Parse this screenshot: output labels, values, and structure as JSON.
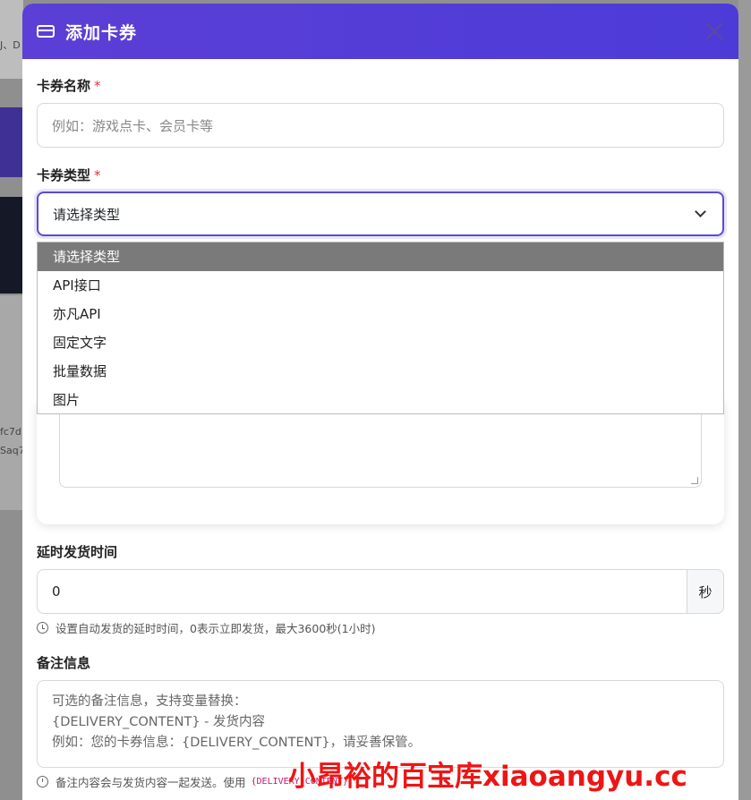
{
  "background": {
    "text_1": "J、D",
    "text_2": "fc7d",
    "text_3": "Saq7"
  },
  "modal": {
    "title": "添加卡券",
    "icon": "credit-card-icon"
  },
  "form": {
    "card_name": {
      "label": "卡券名称",
      "required_mark": "*",
      "placeholder": "例如：游戏点卡、会员卡等"
    },
    "card_type": {
      "label": "卡券类型",
      "required_mark": "*",
      "selected": "请选择类型",
      "options": [
        "请选择类型",
        "API接口",
        "亦凡API",
        "固定文字",
        "批量数据",
        "图片"
      ]
    },
    "delay": {
      "label": "延时发货时间",
      "value": "0",
      "unit": "秒",
      "help": "设置自动发货的延时时间，0表示立即发货，最大3600秒(1小时)"
    },
    "notes": {
      "label": "备注信息",
      "placeholder_lines": [
        "可选的备注信息，支持变量替换：",
        "{DELIVERY_CONTENT} - 发货内容",
        "例如：您的卡券信息：{DELIVERY_CONTENT}，请妥善保管。"
      ],
      "help_prefix": "备注内容会与发货内容一起发送。使用",
      "help_code": "{DELIVERY_CONTENT}"
    }
  },
  "watermark": "小昂裕的百宝库xiaoangyu.cc",
  "colors": {
    "header": "#5b3fd6",
    "required": "#dc3545",
    "selected_option_bg": "#7a7a7a",
    "watermark": "#ee1515"
  }
}
